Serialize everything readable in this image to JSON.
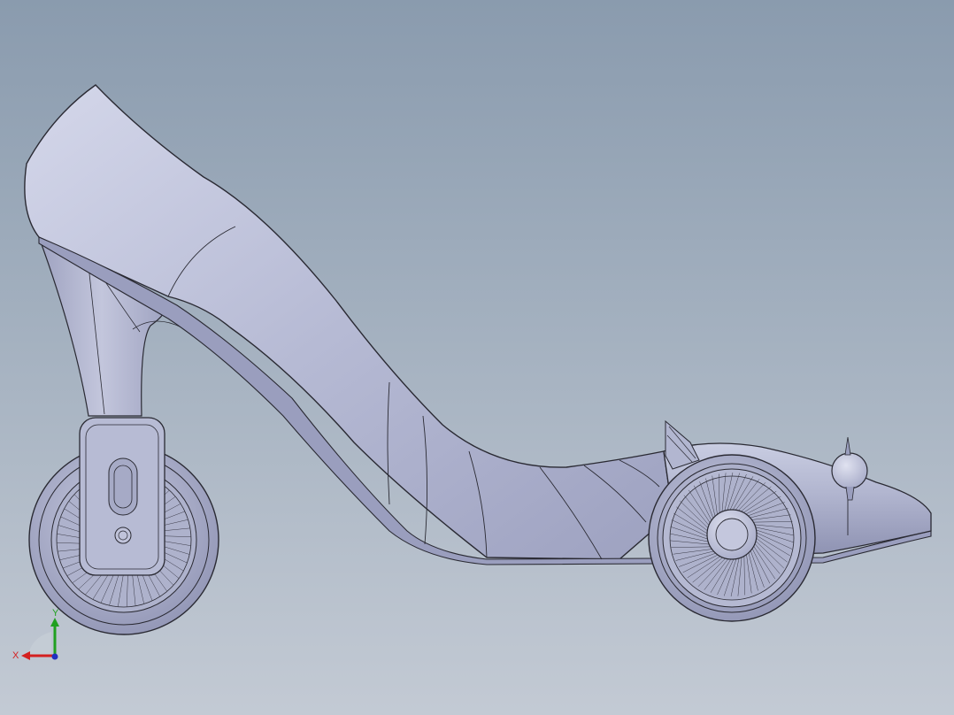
{
  "viewport": {
    "background_top": "#8a9bae",
    "background_bottom": "#c3cad4",
    "model_fill": "#b4b8d2",
    "edge_color": "#2a2a33"
  },
  "model": {
    "parts": [
      "shoe-body",
      "heel-column",
      "rear-wheel",
      "front-wheel",
      "headlight",
      "fin"
    ]
  },
  "triad": {
    "x_label": "X",
    "y_label": "Y",
    "x_color": "#d42020",
    "y_color": "#20a020",
    "z_color": "#2030c0"
  }
}
